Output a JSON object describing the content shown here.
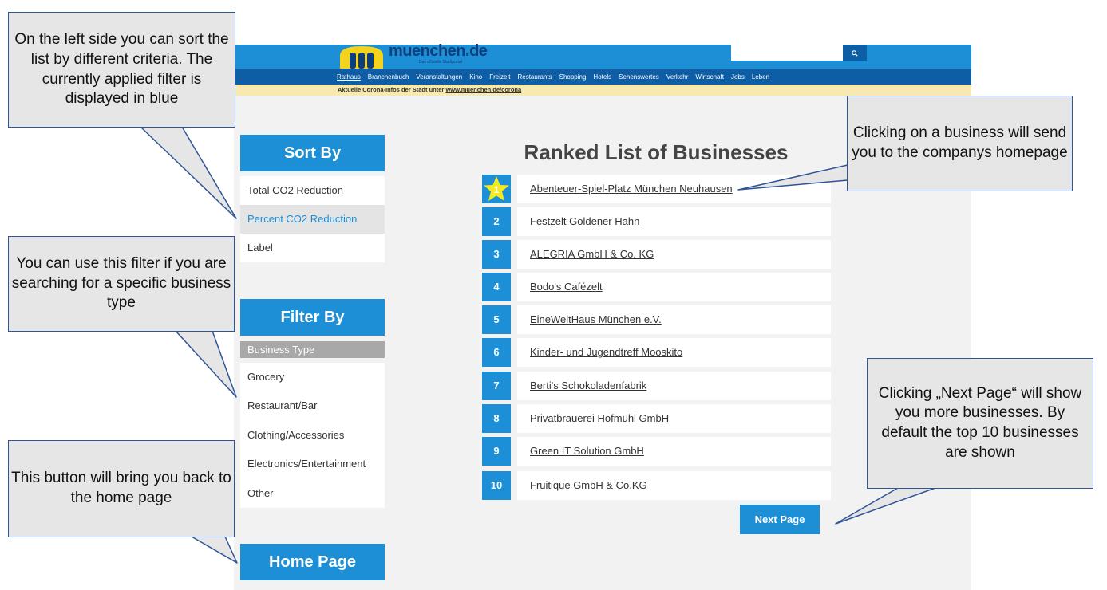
{
  "header": {
    "logo_text": "muenchen.de",
    "logo_sub": "Das offizielle Stadtportal",
    "search_icon": "search-icon",
    "nav": [
      "Rathaus",
      "Branchenbuch",
      "Veranstaltungen",
      "Kino",
      "Freizeit",
      "Restaurants",
      "Shopping",
      "Hotels",
      "Sehenswertes",
      "Verkehr",
      "Wirtschaft",
      "Jobs",
      "Leben"
    ],
    "banner_prefix": "Aktuelle Corona-Infos der Stadt unter ",
    "banner_link": "www.muenchen.de/corona"
  },
  "sort": {
    "heading": "Sort By",
    "items": [
      "Total CO2 Reduction",
      "Percent CO2 Reduction",
      "Label"
    ],
    "active_index": 1
  },
  "filter": {
    "heading": "Filter By",
    "subheading": "Business Type",
    "items": [
      "Grocery",
      "Restaurant/Bar",
      "Clothing/Accessories",
      "Electronics/Entertainment",
      "Other"
    ]
  },
  "home_button": "Home Page",
  "main": {
    "title": "Ranked List of Businesses",
    "businesses": [
      {
        "rank": "1",
        "name": "Abenteuer-Spiel-Platz  München Neuhausen"
      },
      {
        "rank": "2",
        "name": "Festzelt Goldener Hahn"
      },
      {
        "rank": "3",
        "name": "ALEGRIA GmbH & Co. KG "
      },
      {
        "rank": "4",
        "name": "Bodo's Cafézelt"
      },
      {
        "rank": "5",
        "name": "EineWeltHaus München e.V."
      },
      {
        "rank": "6",
        "name": "Kinder- und Jugendtreff Mooskito"
      },
      {
        "rank": "7",
        "name": "Berti's Schokoladenfabrik"
      },
      {
        "rank": "8",
        "name": "Privatbrauerei Hofmühl GmbH"
      },
      {
        "rank": "9",
        "name": "Green IT Solution GmbH"
      },
      {
        "rank": "10",
        "name": "Fruitique GmbH & Co.KG"
      }
    ],
    "next_button": "Next Page"
  },
  "callouts": {
    "sort": "On the left side you can sort the list by different criteria. The currently applied filter is displayed in blue",
    "filter": "You can use this filter if you are searching for a specific business type",
    "home": "This button will bring you back to the home page",
    "business": "Clicking on a business will send you to the companys homepage",
    "next": "Clicking „Next Page“ will show you more businesses. By default the top 10 businesses are shown"
  },
  "colors": {
    "accent": "#1c8fd6",
    "nav": "#0e5ea6",
    "callout_border": "#2f5597",
    "callout_fill": "#e6e6e6",
    "star": "#f5ea1c"
  }
}
